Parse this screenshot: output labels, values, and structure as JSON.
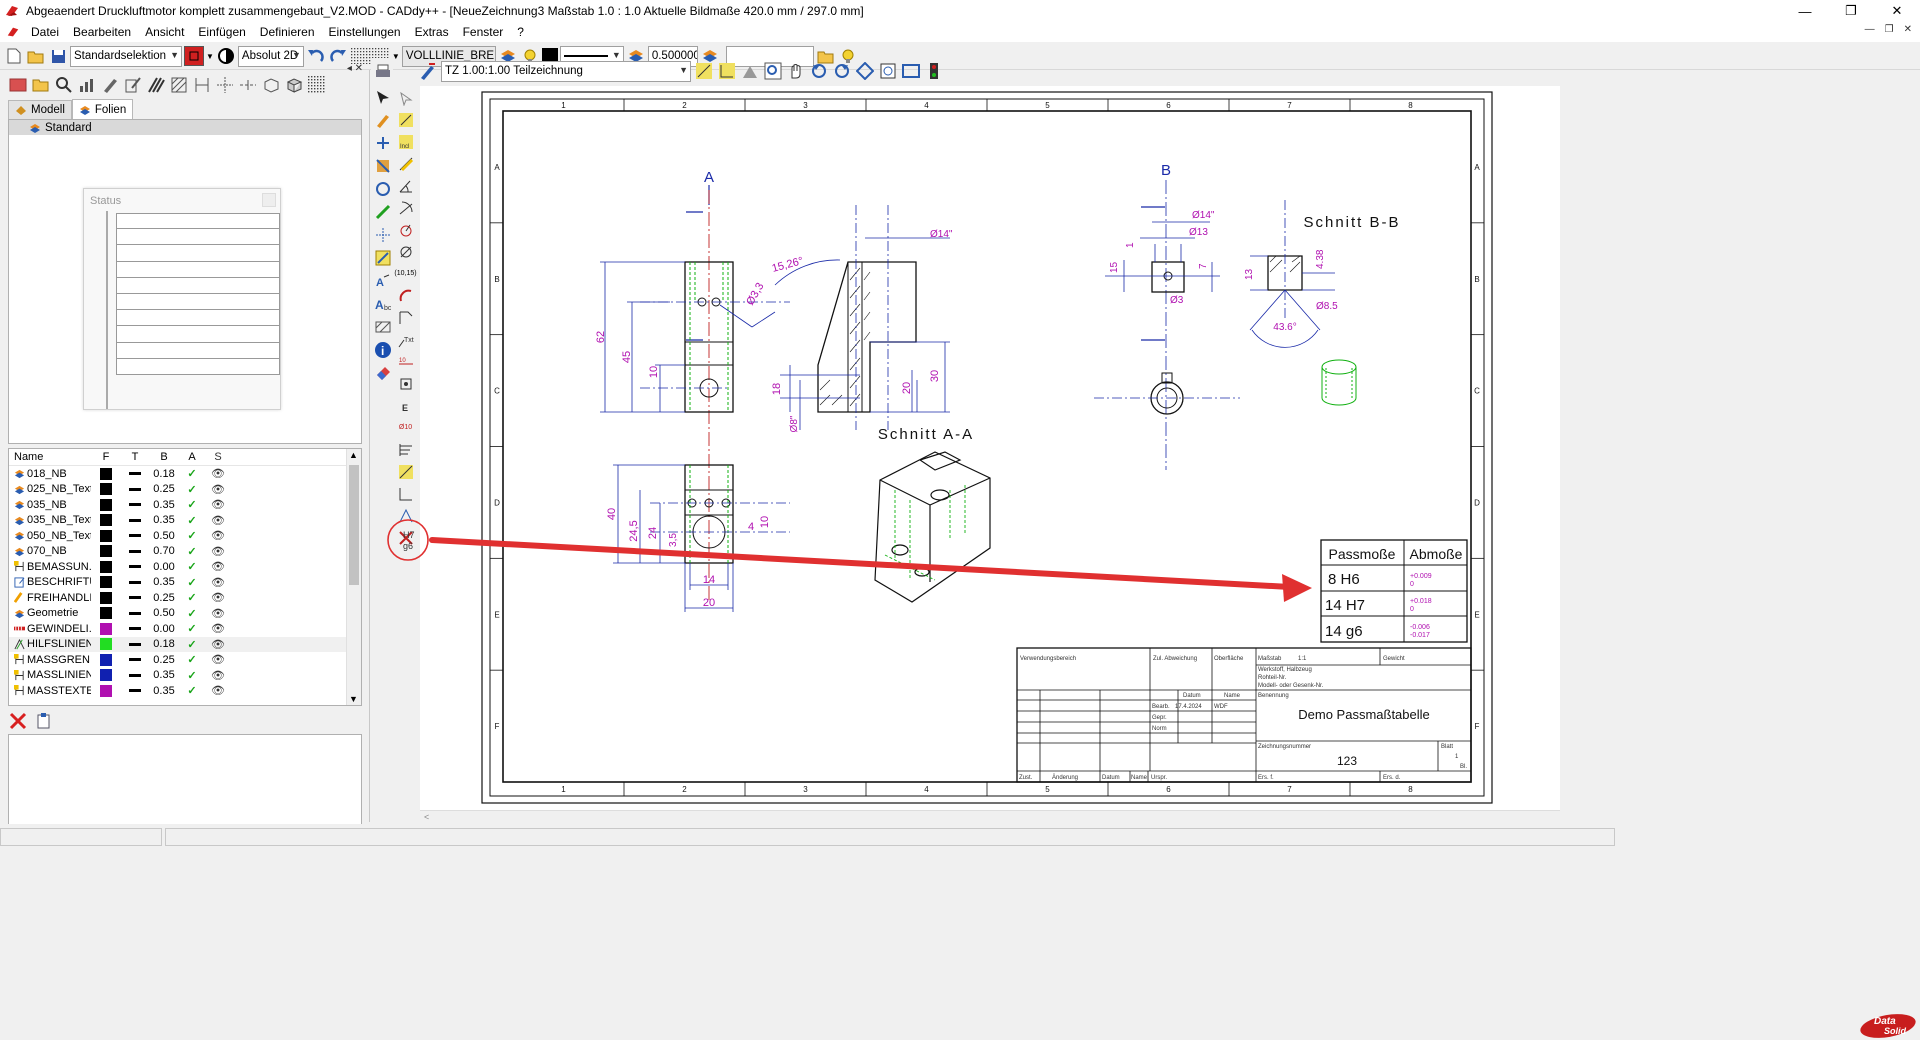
{
  "window": {
    "title": "Abgeaendert Druckluftmotor komplett zusammengebaut_V2.MOD  -  CADdy++ - [NeueZeichnung3    Maßstab 1.0 : 1.0    Aktuelle Bildmaße 420.0 mm / 297.0 mm]",
    "minimize": "—",
    "maximize": "❐",
    "close": "✕"
  },
  "menu": [
    "Datei",
    "Bearbeiten",
    "Ansicht",
    "Einfügen",
    "Definieren",
    "Einstellungen",
    "Extras",
    "Fenster",
    "?"
  ],
  "toolbar": {
    "selection_mode": "Standardselektion",
    "coord_mode": "Absolut 2D",
    "linetype": "VOLLLINIE_BREIT",
    "line_width": "0.500000",
    "search_value": ""
  },
  "cad_toolbar": {
    "view_select": "TZ 1.00:1.00 Teilzeichnung"
  },
  "left_panel": {
    "tabs": [
      {
        "label": "Modell",
        "active": false
      },
      {
        "label": "Folien",
        "active": true
      }
    ],
    "tree_root": "Standard",
    "status_window_title": "Status",
    "status_rows": 10,
    "layer_columns": {
      "name": "Name",
      "f": "F",
      "t": "T",
      "b": "B",
      "a": "A",
      "s": "S"
    },
    "layers": [
      {
        "name": "018_NB",
        "color": "#000000",
        "b": "0.18",
        "icon": "layer"
      },
      {
        "name": "025_NB_Text",
        "color": "#000000",
        "b": "0.25",
        "icon": "layer"
      },
      {
        "name": "035_NB",
        "color": "#000000",
        "b": "0.35",
        "icon": "layer"
      },
      {
        "name": "035_NB_Text",
        "color": "#000000",
        "b": "0.35",
        "icon": "layer"
      },
      {
        "name": "050_NB_Text",
        "color": "#000000",
        "b": "0.50",
        "icon": "layer"
      },
      {
        "name": "070_NB",
        "color": "#000000",
        "b": "0.70",
        "icon": "layer"
      },
      {
        "name": "BEMASSUN...",
        "color": "#000000",
        "b": "0.00",
        "icon": "dim"
      },
      {
        "name": "BESCHRIFTU...",
        "color": "#000000",
        "b": "0.35",
        "icon": "text"
      },
      {
        "name": "FREIHANDLI...",
        "color": "#000000",
        "b": "0.25",
        "icon": "free"
      },
      {
        "name": "Geometrie",
        "color": "#000000",
        "b": "0.50",
        "icon": "layer"
      },
      {
        "name": "GEWINDELI...",
        "color": "#b010b0",
        "b": "0.00",
        "icon": "thread"
      },
      {
        "name": "HILFSLINIEN",
        "color": "#22dd22",
        "b": "0.18",
        "icon": "help"
      },
      {
        "name": "MASSGREN...",
        "color": "#1020b0",
        "b": "0.25",
        "icon": "dim"
      },
      {
        "name": "MASSLINIEN",
        "color": "#1020b0",
        "b": "0.35",
        "icon": "dim"
      },
      {
        "name": "MASSTEXTE",
        "color": "#b010b0",
        "b": "0.35",
        "icon": "dim"
      }
    ]
  },
  "drawing": {
    "columns": [
      "1",
      "2",
      "3",
      "4",
      "5",
      "6",
      "7",
      "8"
    ],
    "rows": [
      "A",
      "B",
      "C",
      "D",
      "E",
      "F"
    ],
    "view_a_label": "A",
    "view_b_label": "B",
    "section_aa": "Schnitt A-A",
    "section_bb": "Schnitt B-B",
    "dims_front": [
      "62",
      "45",
      "10",
      "Ø3,3"
    ],
    "dims_section_a": [
      "15,26°",
      "Ø14\"",
      "18",
      "20",
      "30",
      "Ø8\""
    ],
    "dims_bottom": [
      "40",
      "24,5",
      "24",
      "3,5",
      "4",
      "10",
      "14",
      "20"
    ],
    "dims_b": [
      "Ø14\"",
      "Ø13",
      "1",
      "15",
      "7",
      "Ø3"
    ],
    "dims_section_b": [
      "4.38",
      "13",
      "Ø8.5",
      "43.6°"
    ],
    "fit_table": {
      "headers": [
        "Passmoße",
        "Abmoße"
      ],
      "rows": [
        {
          "fit": "8 H6",
          "upper": "+0.009",
          "lower": "0"
        },
        {
          "fit": "14 H7",
          "upper": "+0.018",
          "lower": "0"
        },
        {
          "fit": "14 g6",
          "upper": "-0.006",
          "lower": "-0.017"
        }
      ]
    },
    "title_block": {
      "verwendungsbereich": "Verwendungsbereich",
      "zul_abweichung": "Zul. Abweichung",
      "oberflaeche": "Oberfläche",
      "massstab_label": "Maßstab",
      "massstab_value": "1:1",
      "gewicht": "Gewicht",
      "werkstoff": "Werkstoff, Halbzeug",
      "rohteil": "Rohteil-Nr.",
      "modell": "Modell- oder Gesenk-Nr.",
      "datum_label": "Datum",
      "name_label": "Name",
      "bearb": "Bearb.",
      "bearb_datum": "17.4.2024",
      "bearb_name": "WDF",
      "gepr": "Gepr.",
      "norm": "Norm",
      "benennung": "Benennung",
      "title": "Demo Passmaßtabelle",
      "zeichnungsnummer_label": "Zeichnungsnummer",
      "zeichnungsnummer": "123",
      "blatt_label": "Blatt",
      "blatt_value": "1",
      "blatt_total": "Bl.",
      "zust": "Zust.",
      "aenderung": "Änderung",
      "datum2": "Datum",
      "name2": "Name",
      "urspr": "Urspr.",
      "ers_f": "Ers. f.",
      "ers_d": "Ers. d."
    }
  },
  "tolerance_tool": {
    "top": "H7",
    "bottom": "g6"
  },
  "annotation": {
    "highlight_color": "#e03030"
  },
  "brand": {
    "line1": "Data",
    "line2": "Solid"
  },
  "colors": {
    "dim_blue": "#1a2aa8",
    "dim_magenta": "#b010b0",
    "hidden_green": "#10b010",
    "axis_red": "#c02020"
  }
}
